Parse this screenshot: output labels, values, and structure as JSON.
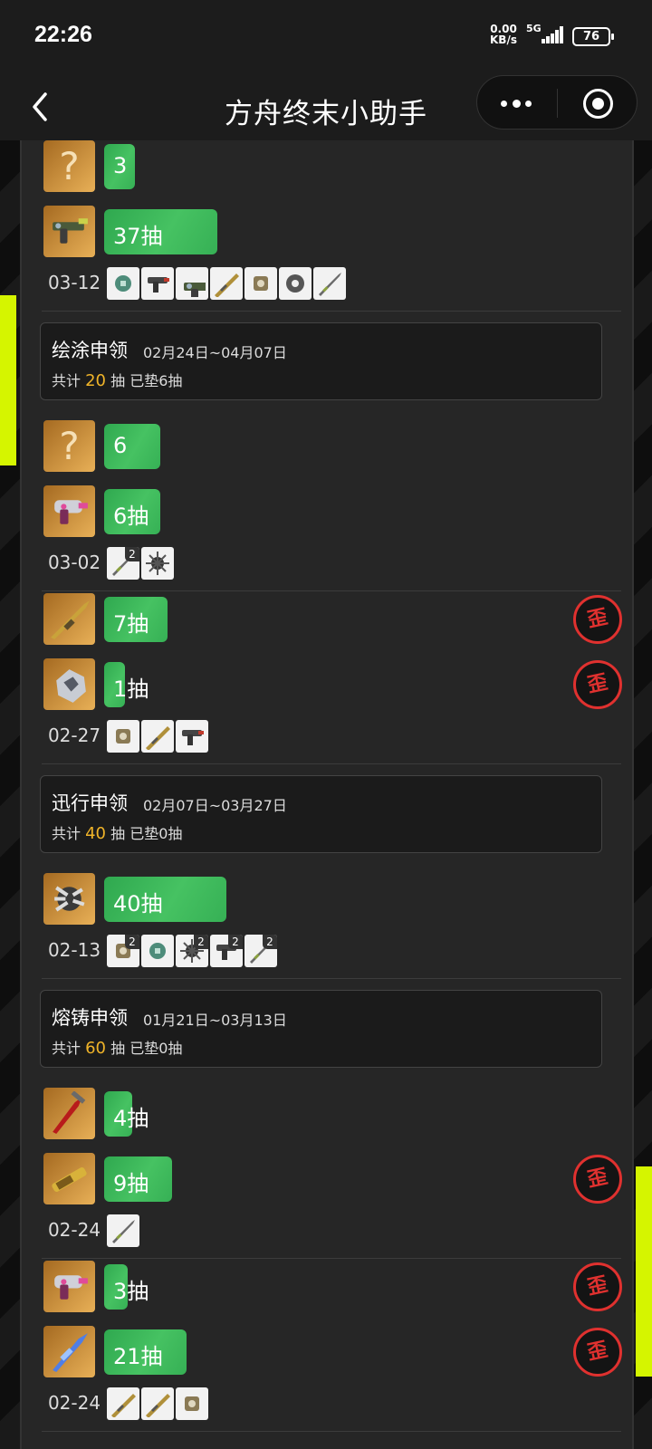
{
  "status_bar": {
    "time": "22:26",
    "speed_value": "0.00",
    "speed_unit": "KB/s",
    "network": "5G",
    "battery": "76"
  },
  "nav": {
    "title": "方舟终末小助手"
  },
  "colors": {
    "progress_bar": "#3bb55a",
    "accent_orange": "#f0b429",
    "warp_red": "#e0312f",
    "highlight": "#d5f500"
  },
  "warp_badge_char": "歪",
  "labels": {
    "total_prefix": "共计",
    "total_suffix": "抽"
  },
  "records": [
    {
      "pulls": [
        {
          "avatar": "question-mark",
          "avatar_symbol": "?",
          "label": "3",
          "progress": 0.13,
          "warp": false
        },
        {
          "avatar": "gun-icon",
          "label": "37抽",
          "progress": 0.48,
          "warp": false
        }
      ],
      "date": "03-12",
      "items": [
        {
          "icon": "gadget-icon",
          "count": ""
        },
        {
          "icon": "pistol-icon",
          "count": ""
        },
        {
          "icon": "gun-icon",
          "count": ""
        },
        {
          "icon": "rod-icon",
          "count": ""
        },
        {
          "icon": "device-icon",
          "count": ""
        },
        {
          "icon": "gear-icon",
          "count": ""
        },
        {
          "icon": "sword-icon",
          "count": ""
        }
      ]
    },
    {
      "banner": {
        "name": "绘涂申领",
        "dates": "02月24日~04月07日",
        "total": "20",
        "pity_text": "已垫6抽"
      }
    },
    {
      "pulls": [
        {
          "avatar": "question-mark",
          "avatar_symbol": "?",
          "label": "6",
          "progress": 0.24,
          "warp": false
        },
        {
          "avatar": "blaster-icon",
          "label": "6抽",
          "progress": 0.24,
          "warp": false
        }
      ],
      "date": "03-02",
      "items": [
        {
          "icon": "sword-icon",
          "count": "2"
        },
        {
          "icon": "spikeball-icon",
          "count": ""
        }
      ]
    },
    {
      "pulls": [
        {
          "avatar": "lance-icon",
          "label": "7抽",
          "progress": 0.27,
          "warp": true
        },
        {
          "avatar": "mech-icon",
          "label": "1抽",
          "progress": 0.09,
          "warp": true
        }
      ],
      "date": "02-27",
      "items": [
        {
          "icon": "device-icon",
          "count": ""
        },
        {
          "icon": "rod-icon",
          "count": ""
        },
        {
          "icon": "pistol-icon",
          "count": ""
        }
      ]
    },
    {
      "banner": {
        "name": "迅行申领",
        "dates": "02月07日~03月27日",
        "total": "40",
        "pity_text": "已垫0抽"
      }
    },
    {
      "pulls": [
        {
          "avatar": "claw-icon",
          "label": "40抽",
          "progress": 0.52,
          "warp": false
        }
      ],
      "date": "02-13",
      "items": [
        {
          "icon": "device-icon",
          "count": "2"
        },
        {
          "icon": "gadget-icon",
          "count": ""
        },
        {
          "icon": "spikeball-icon",
          "count": "2"
        },
        {
          "icon": "pistol-icon",
          "count": "2"
        },
        {
          "icon": "sword-icon",
          "count": "2"
        }
      ]
    },
    {
      "banner": {
        "name": "熔铸申领",
        "dates": "01月21日~03月13日",
        "total": "60",
        "pity_text": "已垫0抽"
      }
    },
    {
      "pulls": [
        {
          "avatar": "blade-icon",
          "label": "4抽",
          "progress": 0.12,
          "warp": false
        },
        {
          "avatar": "cannon-icon",
          "label": "9抽",
          "progress": 0.29,
          "warp": true
        }
      ],
      "date": "02-24",
      "items": [
        {
          "icon": "sword-icon",
          "count": ""
        }
      ]
    },
    {
      "pulls": [
        {
          "avatar": "blaster-icon",
          "label": "3抽",
          "progress": 0.1,
          "warp": true
        },
        {
          "avatar": "crystal-sword-icon",
          "label": "21抽",
          "progress": 0.35,
          "warp": true
        }
      ],
      "date": "02-24",
      "items": [
        {
          "icon": "rod-icon",
          "count": ""
        },
        {
          "icon": "rod-icon",
          "count": ""
        },
        {
          "icon": "device-icon",
          "count": ""
        }
      ]
    }
  ]
}
